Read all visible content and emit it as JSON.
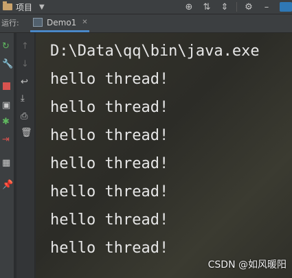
{
  "topbar": {
    "project_label": "项目"
  },
  "runbar": {
    "label": "运行:",
    "tab_label": "Demo1"
  },
  "console": {
    "lines": [
      "D:\\Data\\qq\\bin\\java.exe",
      "hello thread!",
      "hello thread!",
      "hello thread!",
      "hello thread!",
      "hello thread!",
      "hello thread!",
      "hello thread!"
    ]
  },
  "watermark": "CSDN @如风暖阳",
  "icons": {
    "top": [
      "target-icon",
      "collapse-icon",
      "expand-icon",
      "gear-icon"
    ],
    "left": [
      "rerun-icon",
      "wrench-icon",
      "stop-icon",
      "camera-icon",
      "debug-icon",
      "exit-icon",
      "layout-icon",
      "pin-icon"
    ],
    "left2": [
      "up-icon",
      "down-icon",
      "wrap-icon",
      "scroll-end-icon",
      "print-icon",
      "trash-icon"
    ]
  },
  "colors": {
    "accent": "#4a88c7",
    "stop": "#d9534f",
    "rerun": "#5fb85f"
  }
}
